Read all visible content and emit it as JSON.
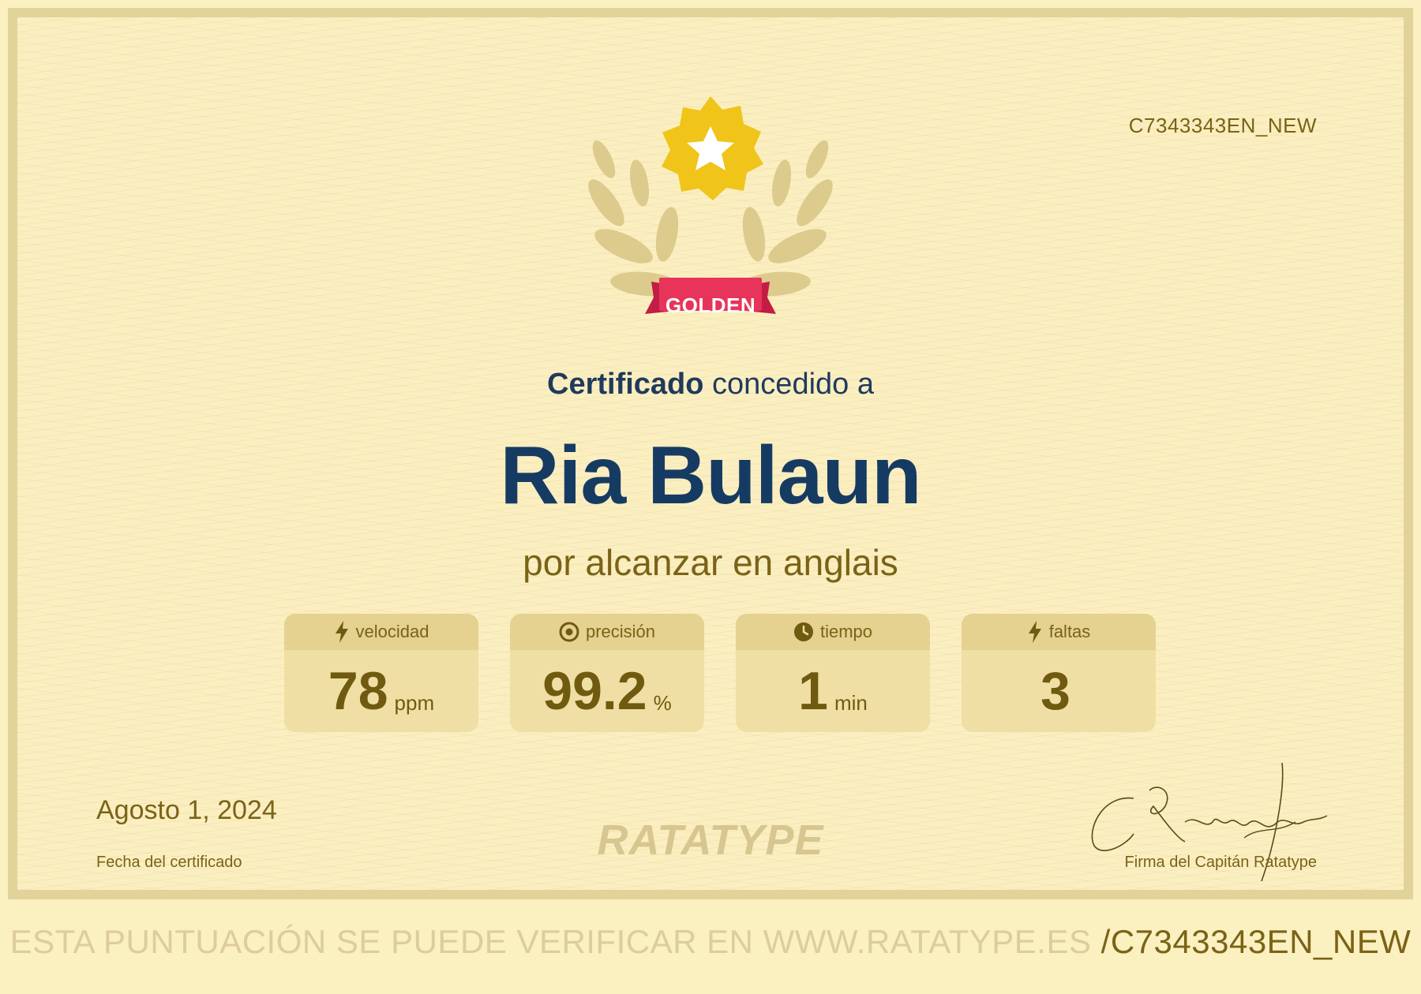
{
  "certificate": {
    "id": "C7343343EN_NEW",
    "badge": "GOLDEN",
    "heading_bold": "Certificado",
    "heading_rest": " concedido a",
    "recipient": "Ria Bulaun",
    "reason": "por alcanzar en anglais",
    "date": "Agosto 1, 2024",
    "date_label": "Fecha del certificado",
    "logo": "RATATYPE",
    "signature_text": "Ratatype",
    "signature_label": "Firma del Capitán Ratatype"
  },
  "stats": [
    {
      "icon": "lightning-icon",
      "label": "velocidad",
      "value": "78",
      "unit": "ppm"
    },
    {
      "icon": "target-icon",
      "label": "precisión",
      "value": "99.2",
      "unit": "%"
    },
    {
      "icon": "clock-icon",
      "label": "tiempo",
      "value": "1",
      "unit": "min"
    },
    {
      "icon": "lightning-icon",
      "label": "faltas",
      "value": "3",
      "unit": ""
    }
  ],
  "footer": {
    "text": "ESTA PUNTUACIÓN SE PUEDE VERIFICAR EN WWW.RATATYPE.ES",
    "id": "/C7343343EN_NEW"
  },
  "colors": {
    "background": "#fbefc1",
    "border": "#e2d39a",
    "navy": "#163b63",
    "olive": "#7a6316",
    "badge_gold": "#f0c419",
    "ribbon_red": "#e8335a"
  }
}
